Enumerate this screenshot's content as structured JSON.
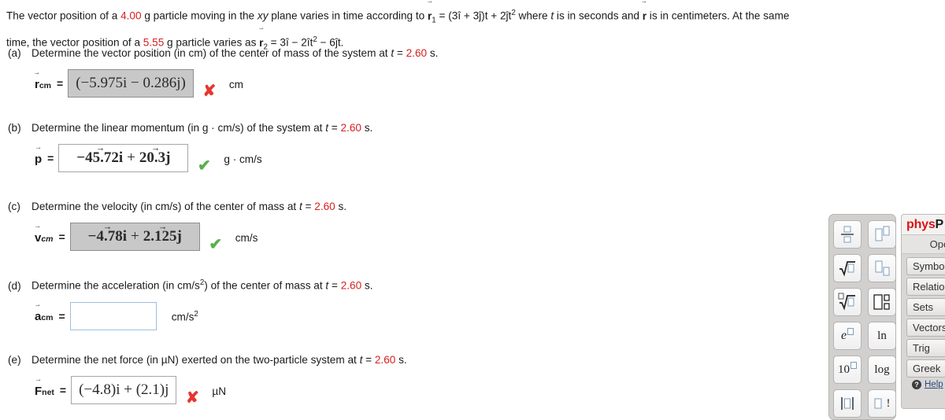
{
  "problem": {
    "line1_pre": "The vector position of a ",
    "mass1": "4.00",
    "line1_mid": " g particle moving in the ",
    "plane": "xy",
    "line1_mid2": " plane varies in time according to ",
    "r1_symbol": "r",
    "r1_sub": "1",
    "r1_expr_eq": " = (3î + 3ĵ)t + 2ĵt",
    "r1_expr_pow": "2",
    "line1_tail_a": " where ",
    "t_sym": "t",
    "line1_tail_b": " is in seconds and ",
    "r_sym": "r",
    "line1_tail_c": " is in centimeters. At the same",
    "line2_pre": "time, the vector position of a ",
    "mass2": "5.55",
    "line2_mid": " g particle varies as ",
    "r2_symbol": "r",
    "r2_sub": "2",
    "r2_expr": " = 3î − 2ît",
    "r2_expr_pow": "2",
    "r2_expr_tail": " − 6ĵt."
  },
  "parts": [
    {
      "label": "(a)",
      "question_pre": "Determine the vector position (in cm) of the center of mass of the system at ",
      "question_t": "t",
      "question_eq": " = ",
      "time": "2.60",
      "question_unit": " s.",
      "lhs_symbol": "r",
      "lhs_sub": "cm",
      "equals": "=",
      "answer": "(−5.975i − 0.286j)",
      "answer_style": "grey",
      "mark": "wrong",
      "mark_glyph": "✘",
      "units": "cm"
    },
    {
      "label": "(b)",
      "question_pre": "Determine the linear momentum (in g · cm/s) of the system at ",
      "question_t": "t",
      "question_eq": " = ",
      "time": "2.60",
      "question_unit": " s.",
      "lhs_symbol": "p",
      "lhs_sub": "",
      "equals": "=",
      "answer_terms": [
        "−45.72i",
        "+",
        "20.3j"
      ],
      "answer_style": "white",
      "mark": "right",
      "mark_glyph": "✔",
      "units": "g · cm/s"
    },
    {
      "label": "(c)",
      "question_pre": "Determine the velocity (in cm/s) of the center of mass at ",
      "question_t": "t",
      "question_eq": " = ",
      "time": "2.60",
      "question_unit": " s.",
      "lhs_symbol": "v",
      "lhs_sub": "cm",
      "equals": "=",
      "answer_terms": [
        "−4.78i",
        "+",
        "2.125j"
      ],
      "answer_style": "grey",
      "mark": "right",
      "mark_glyph": "✔",
      "units": "cm/s"
    },
    {
      "label": "(d)",
      "question_pre": "Determine the acceleration (in cm/s",
      "question_pow": "2",
      "question_pre2": ") of the center of mass at ",
      "question_t": "t",
      "question_eq": " = ",
      "time": "2.60",
      "question_unit": " s.",
      "lhs_symbol": "a",
      "lhs_sub": "cm",
      "equals": "=",
      "answer": "",
      "answer_style": "empty",
      "mark": "none",
      "mark_glyph": "",
      "units": "cm/s",
      "units_pow": "2"
    },
    {
      "label": "(e)",
      "question_pre": "Determine the net force (in µN) exerted on the two-particle system at ",
      "question_t": "t",
      "question_eq": " = ",
      "time": "2.60",
      "question_unit": " s.",
      "lhs_symbol": "F",
      "lhs_sub": "net",
      "equals": "=",
      "answer": "(−4.8)i + (2.1)j",
      "answer_style": "white",
      "mark": "wrong",
      "mark_glyph": "✘",
      "units": "µN"
    }
  ],
  "physpad": {
    "title_red": "phys",
    "title_black": "P",
    "subtitle": "Operati",
    "keys": [
      {
        "name": "fraction-key",
        "glyph": "fraction"
      },
      {
        "name": "superscript-key",
        "glyph": "superscript"
      },
      {
        "name": "square-root-key",
        "glyph": "sqrt"
      },
      {
        "name": "subscript-key",
        "glyph": "subscript"
      },
      {
        "name": "nth-root-key",
        "glyph": "nthroot"
      },
      {
        "name": "sub-superscript-key",
        "glyph": "subsup"
      },
      {
        "name": "exponential-key",
        "glyph": "e"
      },
      {
        "name": "natural-log-key",
        "glyph": "ln"
      },
      {
        "name": "power-of-ten-key",
        "glyph": "10"
      },
      {
        "name": "log-key",
        "glyph": "log"
      },
      {
        "name": "absolute-value-key",
        "glyph": "abs"
      },
      {
        "name": "factorial-key",
        "glyph": "fact"
      }
    ],
    "categories": [
      "Symbol",
      "Relation",
      "Sets",
      "Vectors",
      "Trig",
      "Greek"
    ],
    "help_label": "Help",
    "help_icon": "question-mark"
  },
  "colors": {
    "red_value": "#d81f1f",
    "wrong_mark": "#e8352e",
    "right_mark": "#5aaf4b",
    "brand_red": "#d8131a",
    "input_border_active": "#9cc0e0"
  }
}
